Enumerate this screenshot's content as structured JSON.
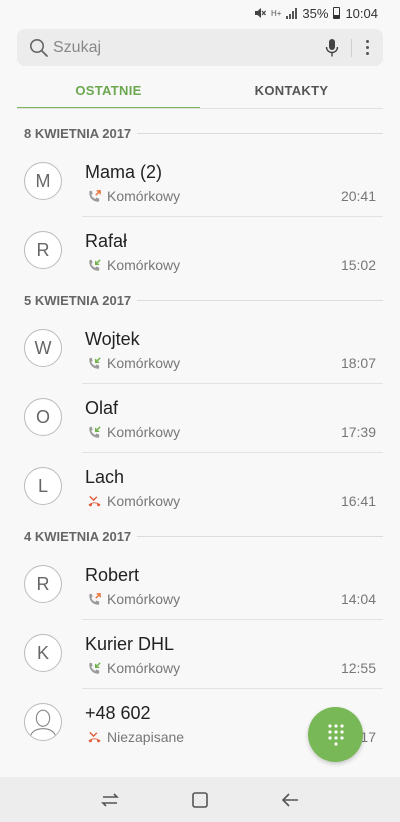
{
  "status_bar": {
    "battery": "35%",
    "time": "10:04",
    "network_label": "H+"
  },
  "search": {
    "placeholder": "Szukaj"
  },
  "tabs": [
    {
      "label": "OSTATNIE",
      "active": true
    },
    {
      "label": "KONTAKTY",
      "active": false
    }
  ],
  "accent_color": "#6ca850",
  "call_colors": {
    "outgoing": "#e8743b",
    "incoming": "#6fb04b",
    "missed": "#e15b37"
  },
  "sections": [
    {
      "date": "8 KWIETNIA 2017",
      "calls": [
        {
          "initial": "M",
          "name": "Mama (2)",
          "type": "Komórkowy",
          "call_icon": "outgoing-call-icon",
          "time": "20:41"
        },
        {
          "initial": "R",
          "name": "Rafał",
          "type": "Komórkowy",
          "call_icon": "incoming-call-icon",
          "time": "15:02"
        }
      ]
    },
    {
      "date": "5 KWIETNIA 2017",
      "calls": [
        {
          "initial": "W",
          "name": "Wojtek",
          "type": "Komórkowy",
          "call_icon": "incoming-call-icon",
          "time": "18:07"
        },
        {
          "initial": "O",
          "name": "Olaf",
          "type": "Komórkowy",
          "call_icon": "incoming-call-icon",
          "time": "17:39"
        },
        {
          "initial": "L",
          "name": "Lach",
          "type": "Komórkowy",
          "call_icon": "missed-call-icon",
          "time": "16:41"
        }
      ]
    },
    {
      "date": "4 KWIETNIA 2017",
      "calls": [
        {
          "initial": "R",
          "name": "Robert",
          "type": "Komórkowy",
          "call_icon": "outgoing-call-icon",
          "time": "14:04"
        },
        {
          "initial": "K",
          "name": "Kurier DHL",
          "type": "Komórkowy",
          "call_icon": "incoming-call-icon",
          "time": "12:55"
        },
        {
          "initial": "",
          "name": "+48 602",
          "type": "Niezapisane",
          "call_icon": "missed-call-icon",
          "time": "11:17",
          "avatar": "person-silhouette-icon"
        }
      ]
    }
  ],
  "fab": {
    "icon": "dialpad-icon"
  },
  "nav_bar": {
    "icons": [
      "recent-apps-icon",
      "home-icon",
      "back-icon"
    ]
  }
}
